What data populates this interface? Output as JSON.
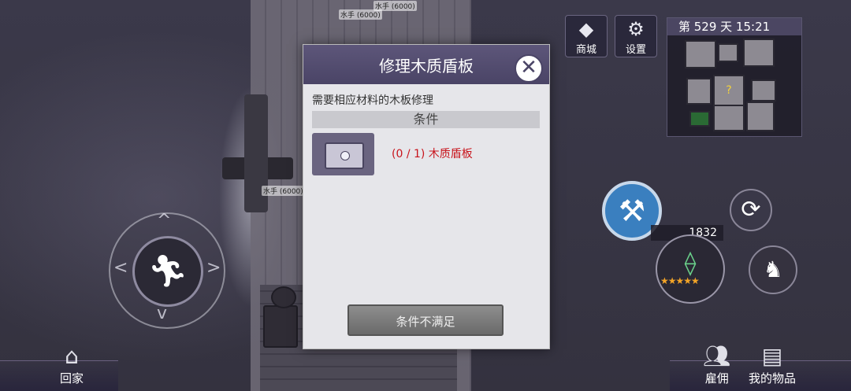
{
  "modal": {
    "title": "修理木质盾板",
    "description": "需要相应材料的木板修理",
    "condition_header": "条件",
    "requirement": "(0 / 1) 木质盾板",
    "confirm_label": "条件不满足"
  },
  "hud": {
    "shop_label": "商城",
    "settings_label": "设置",
    "day_time": "第 529 天   15:21",
    "gold": "1832",
    "weapon_stars": 5
  },
  "bottom": {
    "home_label": "回家",
    "hire_label": "雇佣",
    "inventory_label": "我的物品"
  },
  "world_labels": {
    "crew_1": "水手 (6000)",
    "crew_2": "水手 (6000)",
    "crew_3": "水手 (6000)"
  },
  "colors": {
    "modal_header": "#4a4466",
    "requirement_text": "#c8141c",
    "repair_button": "#3a7fbf"
  },
  "icons": {
    "shop": "diamond-icon",
    "settings": "gear-icon",
    "close": "close-icon",
    "joystick": "running-man-icon",
    "repair": "hammer-wrench-icon",
    "refresh": "refresh-icon",
    "home": "house-icon",
    "hire": "group-icon",
    "inventory": "chest-icon"
  }
}
